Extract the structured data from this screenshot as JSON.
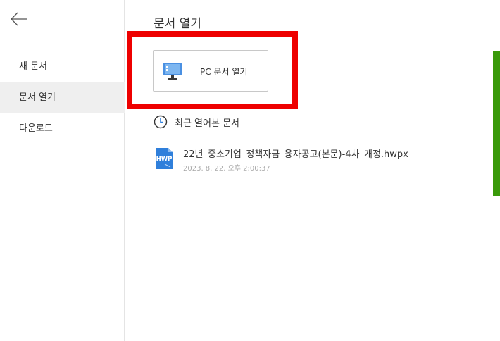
{
  "sidebar": {
    "back_icon": "arrow-left-icon",
    "items": [
      {
        "label": "새 문서",
        "active": false
      },
      {
        "label": "문서 열기",
        "active": true
      },
      {
        "label": "다운로드",
        "active": false
      }
    ]
  },
  "main": {
    "title": "문서 열기",
    "pc_open": {
      "label": "PC 문서 열기",
      "icon": "monitor-icon"
    },
    "recent": {
      "title": "최근 열어본 문서",
      "icon": "clock-icon",
      "files": [
        {
          "name": "22년_중소기업_정책자금_융자공고(본문)-4차_개정.hwpx",
          "date": "2023. 8. 22. 오후 2:00:37",
          "icon": "hwp-file-icon",
          "icon_text": "HWP"
        }
      ]
    }
  },
  "colors": {
    "highlight": "#ee0000",
    "accent_green": "#3a9a0a",
    "active_bg": "#efefef",
    "hwp_blue": "#2f7fdb"
  }
}
